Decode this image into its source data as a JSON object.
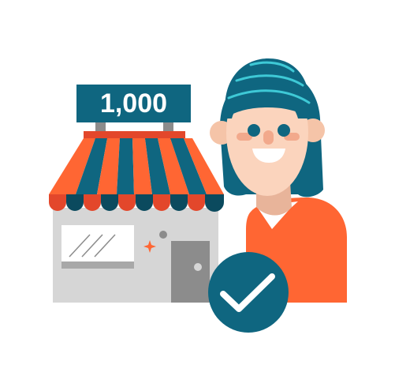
{
  "sign": {
    "label": "1,000"
  },
  "icons": {
    "store": "storefront-icon",
    "person": "smiling-person-icon",
    "badge": "checkmark-badge-icon",
    "sparkle": "sparkle-icon"
  },
  "colors": {
    "teal": "#0f6680",
    "orange": "#ff6633",
    "red_orange": "#e3472b",
    "skin": "#fbd4bd",
    "skin_shadow": "#e8b49a",
    "gray": "#d6d6d6",
    "dark_gray": "#8c8c8c",
    "white": "#ffffff"
  }
}
